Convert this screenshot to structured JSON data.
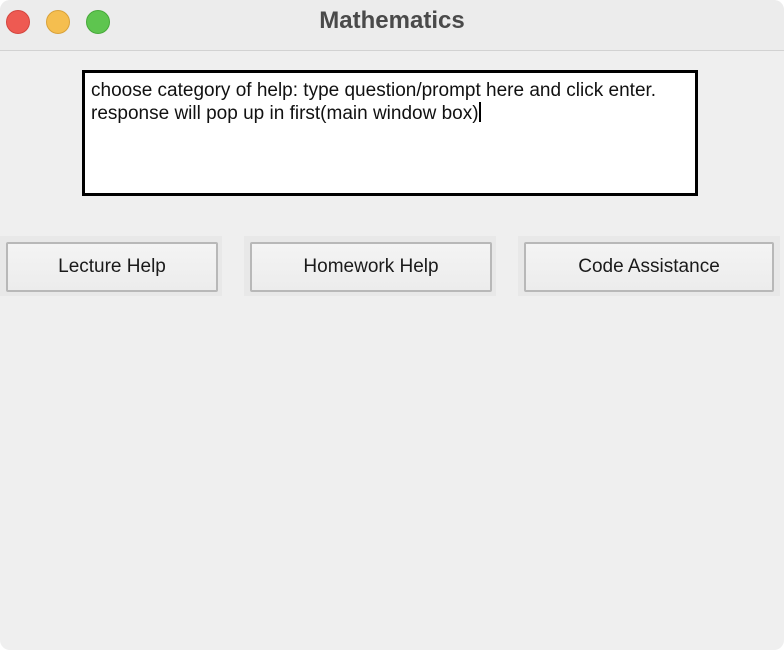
{
  "window": {
    "title": "Mathematics"
  },
  "prompt_box": {
    "text": "choose category of help: type question/prompt here and click enter. response will pop up in first(main window box)"
  },
  "buttons": {
    "lecture_help": "Lecture Help",
    "homework_help": "Homework Help",
    "code_assistance": "Code Assistance"
  },
  "colors": {
    "close": "#ee5a52",
    "minimize": "#f5be4f",
    "zoom": "#5ec54f",
    "window_bg": "#efefef"
  }
}
